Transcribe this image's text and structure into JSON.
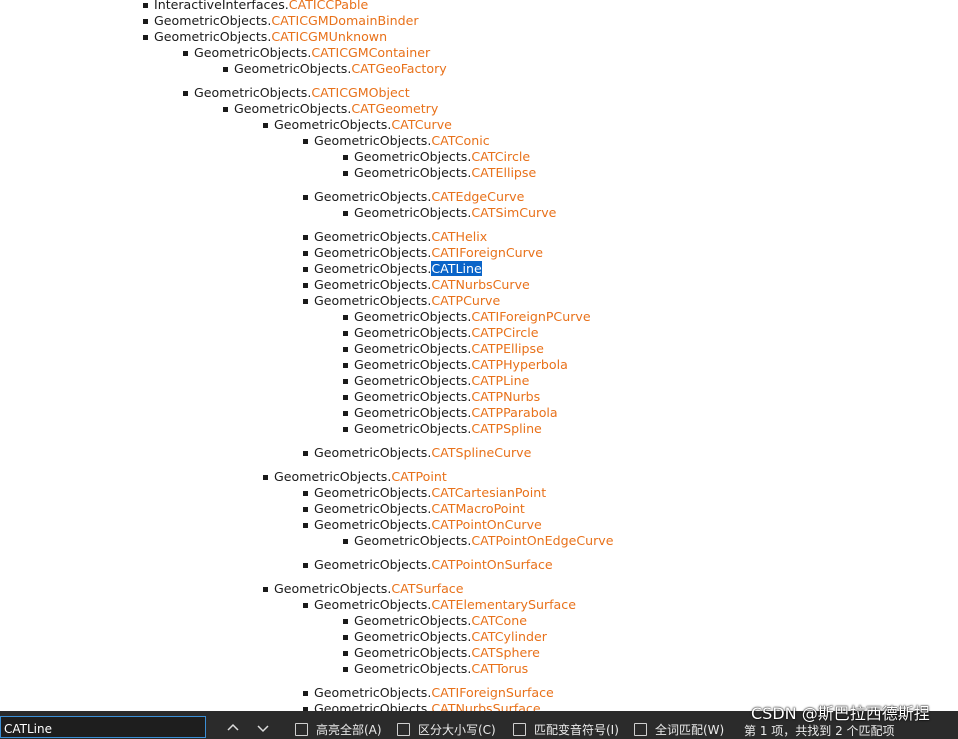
{
  "tree": [
    {
      "level": 1,
      "prefix": "InteractiveInterfaces.",
      "link": "CATICCPable"
    },
    {
      "level": 1,
      "prefix": "GeometricObjects.",
      "link": "CATICGMDomainBinder"
    },
    {
      "level": 1,
      "prefix": "GeometricObjects.",
      "link": "CATICGMUnknown"
    },
    {
      "level": 2,
      "prefix": "GeometricObjects.",
      "link": "CATICGMContainer"
    },
    {
      "level": 3,
      "prefix": "GeometricObjects.",
      "link": "CATGeoFactory",
      "gap_after": true
    },
    {
      "level": 2,
      "prefix": "GeometricObjects.",
      "link": "CATICGMObject"
    },
    {
      "level": 3,
      "prefix": "GeometricObjects.",
      "link": "CATGeometry"
    },
    {
      "level": 4,
      "prefix": "GeometricObjects.",
      "link": "CATCurve"
    },
    {
      "level": 5,
      "prefix": "GeometricObjects.",
      "link": "CATConic"
    },
    {
      "level": 6,
      "prefix": "GeometricObjects.",
      "link": "CATCircle"
    },
    {
      "level": 6,
      "prefix": "GeometricObjects.",
      "link": "CATEllipse",
      "gap_after": true
    },
    {
      "level": 5,
      "prefix": "GeometricObjects.",
      "link": "CATEdgeCurve"
    },
    {
      "level": 6,
      "prefix": "GeometricObjects.",
      "link": "CATSimCurve",
      "gap_after": true
    },
    {
      "level": 5,
      "prefix": "GeometricObjects.",
      "link": "CATHelix"
    },
    {
      "level": 5,
      "prefix": "GeometricObjects.",
      "link": "CATIForeignCurve"
    },
    {
      "level": 5,
      "prefix": "GeometricObjects.",
      "link": "CATLine",
      "highlight": true
    },
    {
      "level": 5,
      "prefix": "GeometricObjects.",
      "link": "CATNurbsCurve"
    },
    {
      "level": 5,
      "prefix": "GeometricObjects.",
      "link": "CATPCurve"
    },
    {
      "level": 6,
      "prefix": "GeometricObjects.",
      "link": "CATIForeignPCurve"
    },
    {
      "level": 6,
      "prefix": "GeometricObjects.",
      "link": "CATPCircle"
    },
    {
      "level": 6,
      "prefix": "GeometricObjects.",
      "link": "CATPEllipse"
    },
    {
      "level": 6,
      "prefix": "GeometricObjects.",
      "link": "CATPHyperbola"
    },
    {
      "level": 6,
      "prefix": "GeometricObjects.",
      "link": "CATPLine"
    },
    {
      "level": 6,
      "prefix": "GeometricObjects.",
      "link": "CATPNurbs"
    },
    {
      "level": 6,
      "prefix": "GeometricObjects.",
      "link": "CATPParabola"
    },
    {
      "level": 6,
      "prefix": "GeometricObjects.",
      "link": "CATPSpline",
      "gap_after": true
    },
    {
      "level": 5,
      "prefix": "GeometricObjects.",
      "link": "CATSplineCurve",
      "gap_after": true
    },
    {
      "level": 4,
      "prefix": "GeometricObjects.",
      "link": "CATPoint"
    },
    {
      "level": 5,
      "prefix": "GeometricObjects.",
      "link": "CATCartesianPoint"
    },
    {
      "level": 5,
      "prefix": "GeometricObjects.",
      "link": "CATMacroPoint"
    },
    {
      "level": 5,
      "prefix": "GeometricObjects.",
      "link": "CATPointOnCurve"
    },
    {
      "level": 6,
      "prefix": "GeometricObjects.",
      "link": "CATPointOnEdgeCurve",
      "gap_after": true
    },
    {
      "level": 5,
      "prefix": "GeometricObjects.",
      "link": "CATPointOnSurface",
      "gap_after": true
    },
    {
      "level": 4,
      "prefix": "GeometricObjects.",
      "link": "CATSurface"
    },
    {
      "level": 5,
      "prefix": "GeometricObjects.",
      "link": "CATElementarySurface"
    },
    {
      "level": 6,
      "prefix": "GeometricObjects.",
      "link": "CATCone"
    },
    {
      "level": 6,
      "prefix": "GeometricObjects.",
      "link": "CATCylinder"
    },
    {
      "level": 6,
      "prefix": "GeometricObjects.",
      "link": "CATSphere"
    },
    {
      "level": 6,
      "prefix": "GeometricObjects.",
      "link": "CATTorus",
      "gap_after": true
    },
    {
      "level": 5,
      "prefix": "GeometricObjects.",
      "link": "CATIForeignSurface"
    },
    {
      "level": 5,
      "prefix": "GeometricObjects.",
      "link": "CATNurbsSurface"
    }
  ],
  "findbar": {
    "query": "CATLine",
    "prev_icon": "chevron-up-icon",
    "next_icon": "chevron-down-icon",
    "options": [
      {
        "label": "高亮全部(A)",
        "checked": false
      },
      {
        "label": "区分大小写(C)",
        "checked": false
      },
      {
        "label": "匹配变音符号(I)",
        "checked": false
      },
      {
        "label": "全词匹配(W)",
        "checked": false
      }
    ],
    "status": "第 1 项，共找到 2 个匹配项"
  },
  "watermark": "CSDN @斯巴拉西德斯捏",
  "colors": {
    "link": "#e8711a",
    "highlight_bg": "#0a64c8",
    "findbar_bg": "#2b2b2b"
  }
}
